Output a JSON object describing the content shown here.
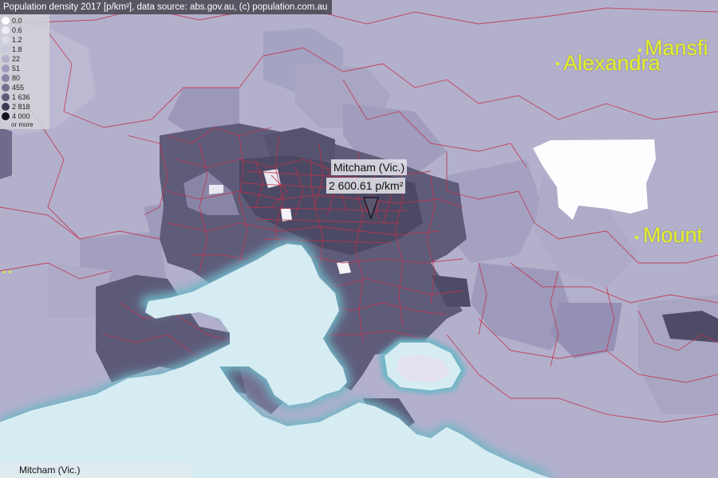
{
  "header": {
    "text": "Population density 2017 [p/km²], data source: abs.gov.au, (c) population.com.au"
  },
  "legend": {
    "items": [
      {
        "label": "0.0",
        "color": "#ffffff"
      },
      {
        "label": "0.6",
        "color": "#ececf2"
      },
      {
        "label": "1.2",
        "color": "#dcdce8"
      },
      {
        "label": "1.8",
        "color": "#c8c8dc"
      },
      {
        "label": "22",
        "color": "#b3b0cc"
      },
      {
        "label": "51",
        "color": "#9d9abb"
      },
      {
        "label": "80",
        "color": "#8985a7"
      },
      {
        "label": "455",
        "color": "#747090"
      },
      {
        "label": "1 636",
        "color": "#5d5a78"
      },
      {
        "label": "2 818",
        "color": "#3e3c52"
      },
      {
        "label": "4 000",
        "color": "#14131c"
      }
    ],
    "more_label": "or more"
  },
  "places": {
    "alexandra": "Alexandra",
    "mansfield": "Mansfi",
    "mount": "Mount"
  },
  "tooltip": {
    "name": "Mitcham (Vic.)",
    "value": "2 600.61 p/km²"
  },
  "footer": {
    "label": "Mitcham (Vic.)"
  },
  "colors": {
    "sea": "#d6ecf3",
    "sea_edge": "#6fb6c6",
    "boundary": "#c2304a",
    "label": "#e6f226"
  }
}
